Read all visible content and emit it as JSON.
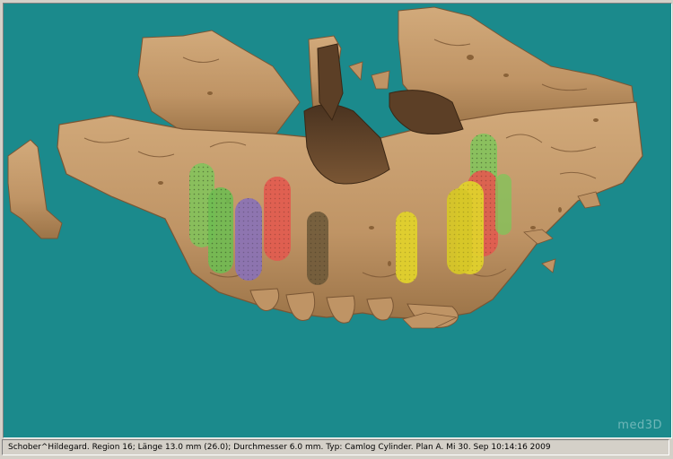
{
  "viewer": {
    "watermark": "med3D",
    "background_color": "#1b8a8c",
    "bone_color": "#bf9465",
    "implant_colors": [
      "#7fc65a",
      "#8a72b6",
      "#e25b4f",
      "#6f5a3a",
      "#e0d12c"
    ]
  },
  "statusbar": {
    "text": "Schober^Hildegard. Region 16; Länge 13.0 mm (26.0); Durchmesser 6.0 mm. Typ: Camlog Cylinder. Plan A. Mi 30. Sep 10:14:16 2009"
  }
}
